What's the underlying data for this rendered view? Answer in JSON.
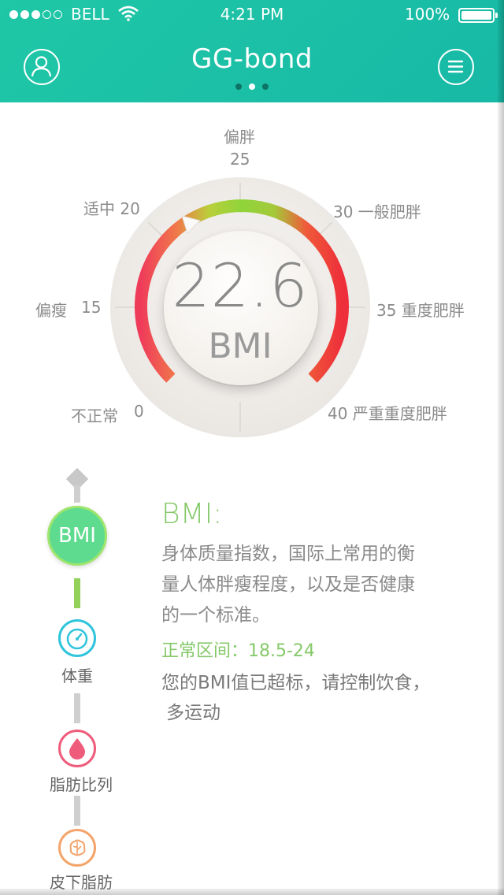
{
  "status_bar": {
    "carrier": "BELL",
    "time": "4:21 PM",
    "battery": "100%"
  },
  "header": {
    "title": "GG-bond",
    "pages": 3,
    "active_page": 2
  },
  "gauge": {
    "value": "22.6",
    "unit": "BMI",
    "labels": {
      "top": "偏胖",
      "top_num": "25",
      "upper_left": "适中 20",
      "left": "偏瘦",
      "left_num": "15",
      "bottom_left": "不正常",
      "bottom_left_num": "0",
      "upper_right": "30 一般肥胖",
      "right": "35 重度肥胖",
      "bottom_right": "40 严重重度肥胖"
    },
    "arc_colors": [
      "#ef3b5a",
      "#f07a4a",
      "#b9cf3a",
      "#8fd43a",
      "#a4c93a",
      "#ef5a3a",
      "#ee2e3a"
    ]
  },
  "nav": {
    "items": [
      {
        "label": "BMI"
      },
      {
        "label": "体重"
      },
      {
        "label": "脂肪比列"
      },
      {
        "label": "皮下脂肪"
      }
    ]
  },
  "info": {
    "title": "BMI:",
    "desc_line1": "身体质量指数，国际上常用的衡",
    "desc_line2": "量人体胖瘦程度，以及是否健康",
    "desc_line3": "的一个标准。",
    "range": "正常区间：18.5-24",
    "advice_line1": "您的BMI值已超标，请控制饮食，",
    "advice_line2": "多运动"
  },
  "colors": {
    "header": "#1fc7a6",
    "accent_green": "#86c96a",
    "weight_icon": "#2ec4dc",
    "fat_icon": "#ef5b7a",
    "subfat_icon": "#f4a46a"
  }
}
